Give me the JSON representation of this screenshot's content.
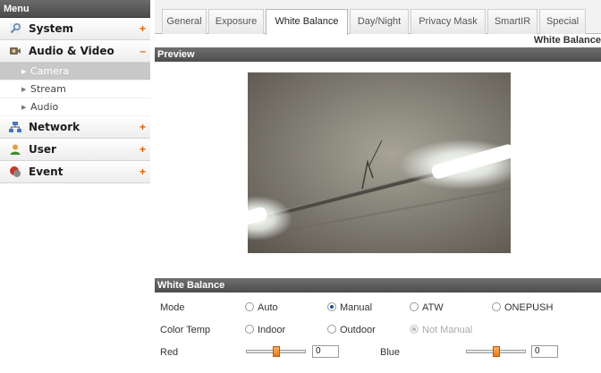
{
  "sidebar": {
    "header": "Menu",
    "sections": [
      {
        "label": "System",
        "toggle": "+"
      },
      {
        "label": "Audio & Video",
        "toggle": "–"
      },
      {
        "label": "Network",
        "toggle": "+"
      },
      {
        "label": "User",
        "toggle": "+"
      },
      {
        "label": "Event",
        "toggle": "+"
      }
    ],
    "sub_items": [
      {
        "label": "Camera"
      },
      {
        "label": "Stream"
      },
      {
        "label": "Audio"
      }
    ]
  },
  "tabs": [
    {
      "label": "General"
    },
    {
      "label": "Exposure"
    },
    {
      "label": "White Balance"
    },
    {
      "label": "Day/Night"
    },
    {
      "label": "Privacy Mask"
    },
    {
      "label": "SmartIR"
    },
    {
      "label": "Special"
    }
  ],
  "active_tab": "White Balance",
  "page_title": "White Balance",
  "preview": {
    "header": "Preview"
  },
  "white_balance": {
    "header": "White Balance",
    "mode": {
      "label": "Mode",
      "options": [
        "Auto",
        "Manual",
        "ATW",
        "ONEPUSH"
      ],
      "selected": "Manual"
    },
    "color_temp": {
      "label": "Color Temp",
      "options": [
        "Indoor",
        "Outdoor",
        "Not Manual"
      ],
      "selected": "Not Manual",
      "disabled": "Not Manual"
    },
    "red": {
      "label": "Red",
      "value": "0",
      "level": 0.5
    },
    "blue": {
      "label": "Blue",
      "value": "0",
      "level": 0.5
    }
  },
  "colors": {
    "accent_orange": "#e06000",
    "header_gray": "#555555",
    "radio_selected": "#1f4f8f"
  }
}
